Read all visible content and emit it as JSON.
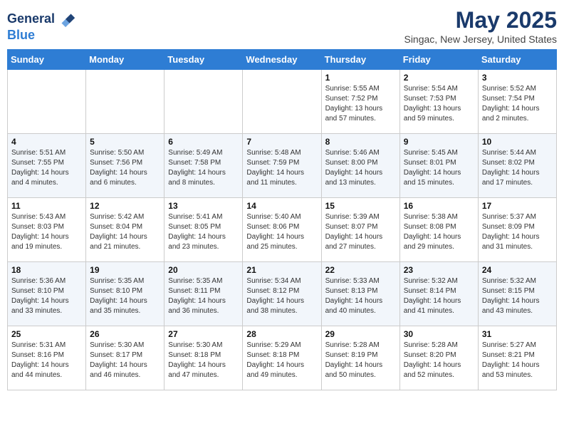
{
  "header": {
    "logo_line1": "General",
    "logo_line2": "Blue",
    "month": "May 2025",
    "location": "Singac, New Jersey, United States"
  },
  "weekdays": [
    "Sunday",
    "Monday",
    "Tuesday",
    "Wednesday",
    "Thursday",
    "Friday",
    "Saturday"
  ],
  "weeks": [
    [
      {
        "day": "",
        "info": ""
      },
      {
        "day": "",
        "info": ""
      },
      {
        "day": "",
        "info": ""
      },
      {
        "day": "",
        "info": ""
      },
      {
        "day": "1",
        "info": "Sunrise: 5:55 AM\nSunset: 7:52 PM\nDaylight: 13 hours\nand 57 minutes."
      },
      {
        "day": "2",
        "info": "Sunrise: 5:54 AM\nSunset: 7:53 PM\nDaylight: 13 hours\nand 59 minutes."
      },
      {
        "day": "3",
        "info": "Sunrise: 5:52 AM\nSunset: 7:54 PM\nDaylight: 14 hours\nand 2 minutes."
      }
    ],
    [
      {
        "day": "4",
        "info": "Sunrise: 5:51 AM\nSunset: 7:55 PM\nDaylight: 14 hours\nand 4 minutes."
      },
      {
        "day": "5",
        "info": "Sunrise: 5:50 AM\nSunset: 7:56 PM\nDaylight: 14 hours\nand 6 minutes."
      },
      {
        "day": "6",
        "info": "Sunrise: 5:49 AM\nSunset: 7:58 PM\nDaylight: 14 hours\nand 8 minutes."
      },
      {
        "day": "7",
        "info": "Sunrise: 5:48 AM\nSunset: 7:59 PM\nDaylight: 14 hours\nand 11 minutes."
      },
      {
        "day": "8",
        "info": "Sunrise: 5:46 AM\nSunset: 8:00 PM\nDaylight: 14 hours\nand 13 minutes."
      },
      {
        "day": "9",
        "info": "Sunrise: 5:45 AM\nSunset: 8:01 PM\nDaylight: 14 hours\nand 15 minutes."
      },
      {
        "day": "10",
        "info": "Sunrise: 5:44 AM\nSunset: 8:02 PM\nDaylight: 14 hours\nand 17 minutes."
      }
    ],
    [
      {
        "day": "11",
        "info": "Sunrise: 5:43 AM\nSunset: 8:03 PM\nDaylight: 14 hours\nand 19 minutes."
      },
      {
        "day": "12",
        "info": "Sunrise: 5:42 AM\nSunset: 8:04 PM\nDaylight: 14 hours\nand 21 minutes."
      },
      {
        "day": "13",
        "info": "Sunrise: 5:41 AM\nSunset: 8:05 PM\nDaylight: 14 hours\nand 23 minutes."
      },
      {
        "day": "14",
        "info": "Sunrise: 5:40 AM\nSunset: 8:06 PM\nDaylight: 14 hours\nand 25 minutes."
      },
      {
        "day": "15",
        "info": "Sunrise: 5:39 AM\nSunset: 8:07 PM\nDaylight: 14 hours\nand 27 minutes."
      },
      {
        "day": "16",
        "info": "Sunrise: 5:38 AM\nSunset: 8:08 PM\nDaylight: 14 hours\nand 29 minutes."
      },
      {
        "day": "17",
        "info": "Sunrise: 5:37 AM\nSunset: 8:09 PM\nDaylight: 14 hours\nand 31 minutes."
      }
    ],
    [
      {
        "day": "18",
        "info": "Sunrise: 5:36 AM\nSunset: 8:10 PM\nDaylight: 14 hours\nand 33 minutes."
      },
      {
        "day": "19",
        "info": "Sunrise: 5:35 AM\nSunset: 8:10 PM\nDaylight: 14 hours\nand 35 minutes."
      },
      {
        "day": "20",
        "info": "Sunrise: 5:35 AM\nSunset: 8:11 PM\nDaylight: 14 hours\nand 36 minutes."
      },
      {
        "day": "21",
        "info": "Sunrise: 5:34 AM\nSunset: 8:12 PM\nDaylight: 14 hours\nand 38 minutes."
      },
      {
        "day": "22",
        "info": "Sunrise: 5:33 AM\nSunset: 8:13 PM\nDaylight: 14 hours\nand 40 minutes."
      },
      {
        "day": "23",
        "info": "Sunrise: 5:32 AM\nSunset: 8:14 PM\nDaylight: 14 hours\nand 41 minutes."
      },
      {
        "day": "24",
        "info": "Sunrise: 5:32 AM\nSunset: 8:15 PM\nDaylight: 14 hours\nand 43 minutes."
      }
    ],
    [
      {
        "day": "25",
        "info": "Sunrise: 5:31 AM\nSunset: 8:16 PM\nDaylight: 14 hours\nand 44 minutes."
      },
      {
        "day": "26",
        "info": "Sunrise: 5:30 AM\nSunset: 8:17 PM\nDaylight: 14 hours\nand 46 minutes."
      },
      {
        "day": "27",
        "info": "Sunrise: 5:30 AM\nSunset: 8:18 PM\nDaylight: 14 hours\nand 47 minutes."
      },
      {
        "day": "28",
        "info": "Sunrise: 5:29 AM\nSunset: 8:18 PM\nDaylight: 14 hours\nand 49 minutes."
      },
      {
        "day": "29",
        "info": "Sunrise: 5:28 AM\nSunset: 8:19 PM\nDaylight: 14 hours\nand 50 minutes."
      },
      {
        "day": "30",
        "info": "Sunrise: 5:28 AM\nSunset: 8:20 PM\nDaylight: 14 hours\nand 52 minutes."
      },
      {
        "day": "31",
        "info": "Sunrise: 5:27 AM\nSunset: 8:21 PM\nDaylight: 14 hours\nand 53 minutes."
      }
    ]
  ]
}
